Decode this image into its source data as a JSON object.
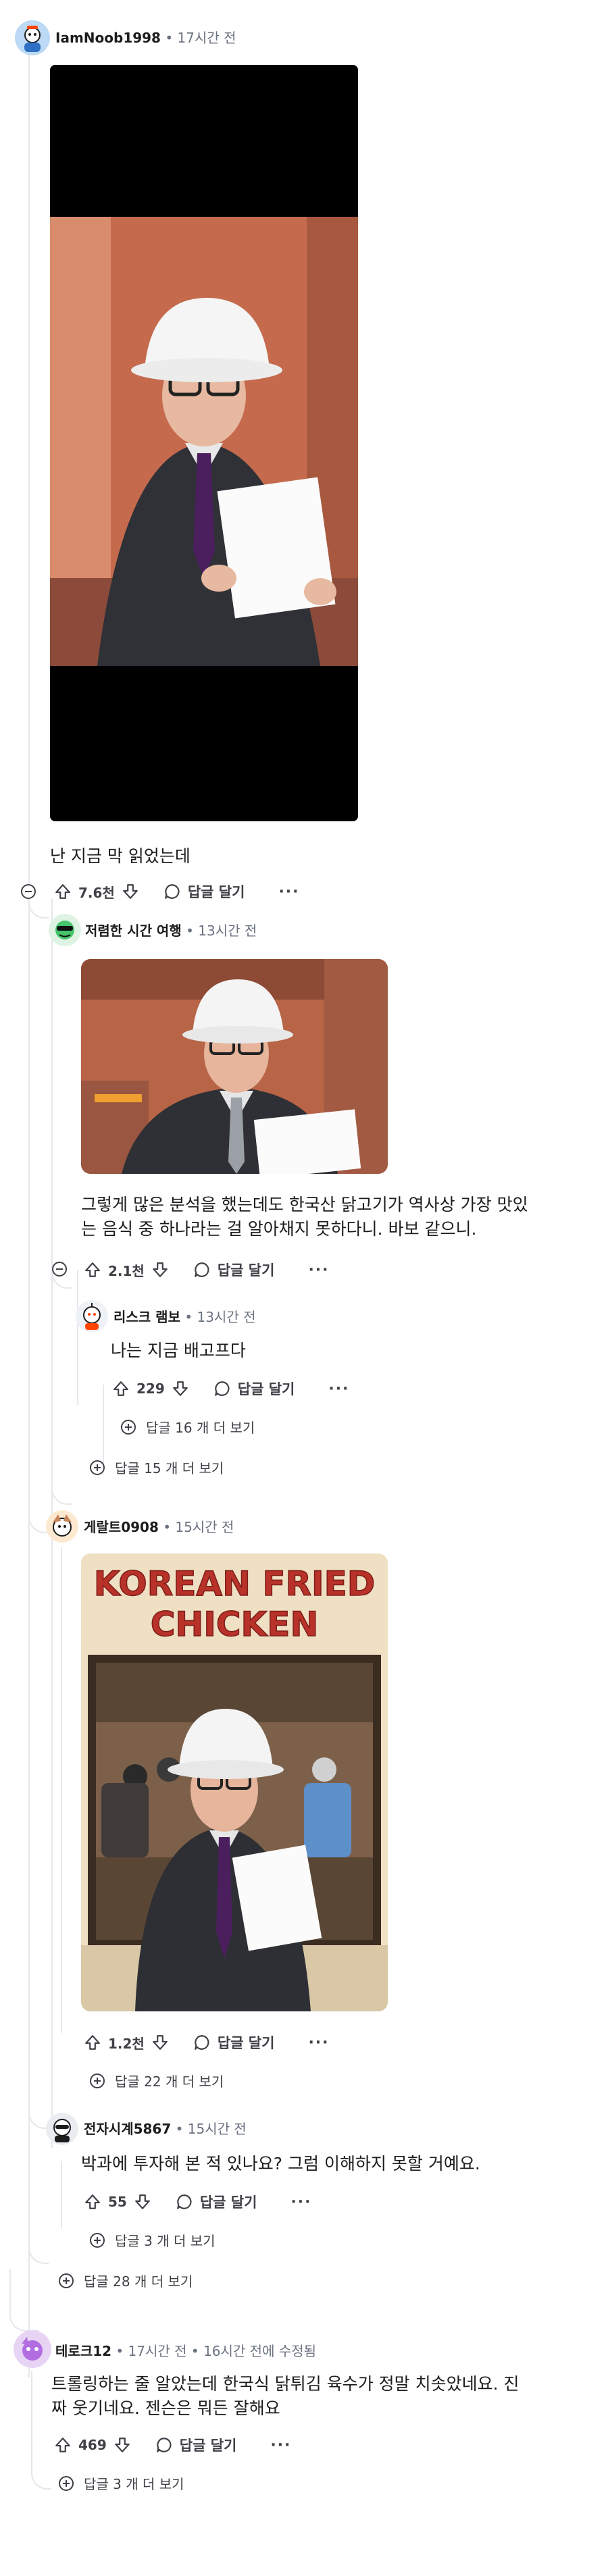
{
  "comments": [
    {
      "author": "IamNoob1998",
      "meta": "• 17시간 전",
      "text": "난 지금 막 읽었는데",
      "votes": "7.6천",
      "reply_label": "답글 달기",
      "more_label": "···",
      "image_alt": "hard-hat-man-reading-video"
    },
    {
      "author": "저렴한 시간 여행",
      "meta": "• 13시간 전",
      "text_line1": "그렇게 많은 분석을 했는데도 한국산 닭고기가 역사상 가장 맛있",
      "text_line2": "는 음식 중 하나라는 걸 알아채지 못하다니. 바보 같으니.",
      "votes": "2.1천",
      "reply_label": "답글 달기",
      "more_label": "···"
    },
    {
      "author": "리스크 램보",
      "meta": "• 13시간 전",
      "text": "나는 지금 배고프다",
      "votes": "229",
      "reply_label": "답글 달기",
      "more_label": "···",
      "more_replies": "답글 16 개 더 보기"
    },
    {
      "author": "게랄트0908",
      "meta": "• 15시간 전",
      "image_sign_line1": "KOREAN FRIED",
      "image_sign_line2": "CHICKEN",
      "votes": "1.2천",
      "reply_label": "답글 달기",
      "more_label": "···",
      "more_replies": "답글 22 개 더 보기"
    },
    {
      "author": "전자시계5867",
      "meta": "• 15시간 전",
      "text": "박과에 투자해 본 적 있나요? 그럼 이해하지 못할 거예요.",
      "votes": "55",
      "reply_label": "답글 달기",
      "more_label": "···",
      "more_replies": "답글 3 개 더 보기"
    },
    {
      "author": "테로크12",
      "meta": "• 17시간 전 • 16시간 전에 수정됨",
      "text_line1": "트롤링하는 줄 알았는데 한국식 닭튀김 육수가 정말 치솟았네요. 진",
      "text_line2": "짜 웃기네요. 젠슨은 뭐든 잘해요",
      "votes": "469",
      "reply_label": "답글 달기",
      "more_label": "···",
      "more_replies": "답글 3 개 더 보기"
    }
  ],
  "thread_more": {
    "c2_more": "답글 15 개 더 보기",
    "c1_more": "답글 28 개 더 보기"
  },
  "colors": {
    "thread_line": "#e5e7eb",
    "meta_text": "#6b7280",
    "text": "#1c1c1c"
  }
}
